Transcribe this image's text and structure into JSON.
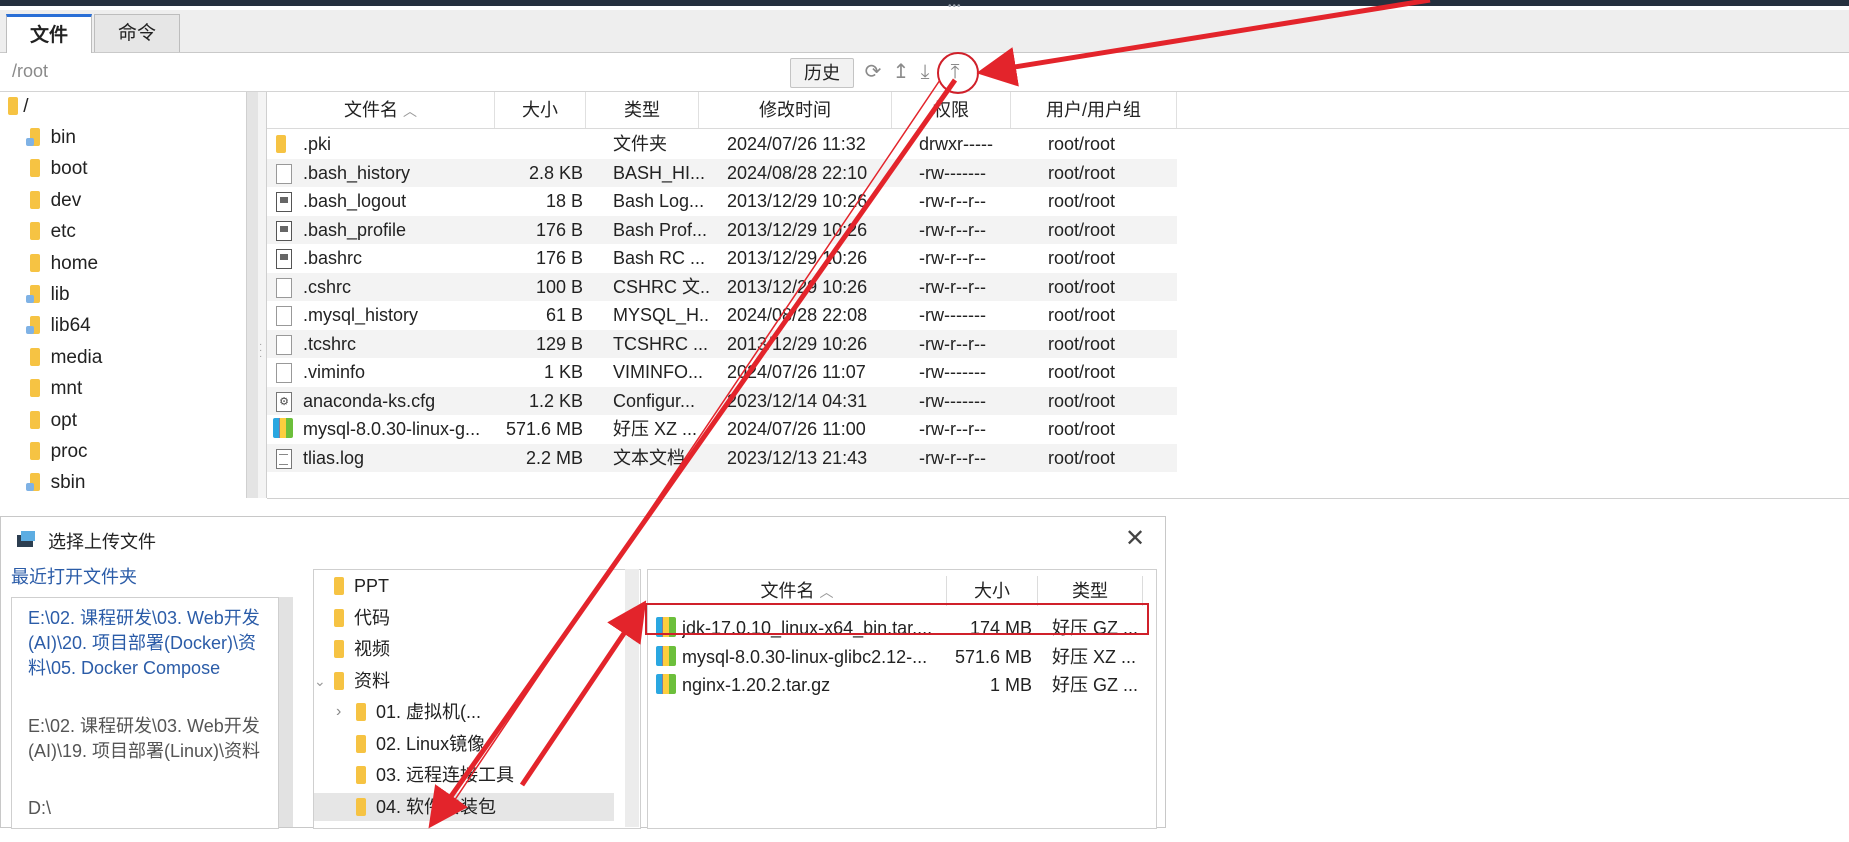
{
  "tabs": [
    {
      "label": "文件",
      "active": true
    },
    {
      "label": "命令",
      "active": false
    }
  ],
  "path_bar": {
    "path": "/root",
    "history_label": "历史",
    "icons": [
      "refresh-icon",
      "up-directory-icon",
      "download-icon",
      "upload-icon"
    ]
  },
  "tree": {
    "root": "/",
    "items": [
      "bin",
      "boot",
      "dev",
      "etc",
      "home",
      "lib",
      "lib64",
      "media",
      "mnt",
      "opt",
      "proc",
      "sbin"
    ]
  },
  "file_list": {
    "columns": [
      "文件名",
      "大小",
      "类型",
      "修改时间",
      "权限",
      "用户/用户组"
    ],
    "rows": [
      {
        "name": ".pki",
        "size": "",
        "type": "文件夹",
        "modified": "2024/07/26 11:32",
        "perm": "drwxr-----",
        "owner": "root/root",
        "icon": "folder"
      },
      {
        "name": ".bash_history",
        "size": "2.8 KB",
        "type": "BASH_HI...",
        "modified": "2024/08/28 22:10",
        "perm": "-rw-------",
        "owner": "root/root",
        "icon": "doc"
      },
      {
        "name": ".bash_logout",
        "size": "18 B",
        "type": "Bash Log...",
        "modified": "2013/12/29 10:26",
        "perm": "-rw-r--r--",
        "owner": "root/root",
        "icon": "doc2"
      },
      {
        "name": ".bash_profile",
        "size": "176 B",
        "type": "Bash Prof...",
        "modified": "2013/12/29 10:26",
        "perm": "-rw-r--r--",
        "owner": "root/root",
        "icon": "doc2"
      },
      {
        "name": ".bashrc",
        "size": "176 B",
        "type": "Bash RC ...",
        "modified": "2013/12/29 10:26",
        "perm": "-rw-r--r--",
        "owner": "root/root",
        "icon": "doc2"
      },
      {
        "name": ".cshrc",
        "size": "100 B",
        "type": "CSHRC 文...",
        "modified": "2013/12/29 10:26",
        "perm": "-rw-r--r--",
        "owner": "root/root",
        "icon": "doc"
      },
      {
        "name": ".mysql_history",
        "size": "61 B",
        "type": "MYSQL_H...",
        "modified": "2024/08/28 22:08",
        "perm": "-rw-------",
        "owner": "root/root",
        "icon": "doc"
      },
      {
        "name": ".tcshrc",
        "size": "129 B",
        "type": "TCSHRC ...",
        "modified": "2013/12/29 10:26",
        "perm": "-rw-r--r--",
        "owner": "root/root",
        "icon": "doc"
      },
      {
        "name": ".viminfo",
        "size": "1 KB",
        "type": "VIMINFO...",
        "modified": "2024/07/26 11:07",
        "perm": "-rw-------",
        "owner": "root/root",
        "icon": "doc"
      },
      {
        "name": "anaconda-ks.cfg",
        "size": "1.2 KB",
        "type": "Configur...",
        "modified": "2023/12/14 04:31",
        "perm": "-rw-------",
        "owner": "root/root",
        "icon": "cfg"
      },
      {
        "name": "mysql-8.0.30-linux-g...",
        "size": "571.6 MB",
        "type": "好压 XZ ...",
        "modified": "2024/07/26 11:00",
        "perm": "-rw-r--r--",
        "owner": "root/root",
        "icon": "archive"
      },
      {
        "name": "tlias.log",
        "size": "2.2 MB",
        "type": "文本文档",
        "modified": "2023/12/13 21:43",
        "perm": "-rw-r--r--",
        "owner": "root/root",
        "icon": "log"
      }
    ]
  },
  "dialog": {
    "title": "选择上传文件",
    "close_glyph": "✕",
    "recent_label": "最近打开文件夹",
    "recent_items": [
      {
        "text": "E:\\02. 课程研发\\03. Web开发(AI)\\20. 项目部署(Docker)\\资料\\05. Docker Compose",
        "highlight": true
      },
      {
        "text": "E:\\02. 课程研发\\03. Web开发(AI)\\19. 项目部署(Linux)\\资料",
        "highlight": false
      },
      {
        "text": "D:\\",
        "highlight": false
      }
    ],
    "folder_tree": [
      {
        "label": "PPT",
        "indent": 0,
        "expander": ""
      },
      {
        "label": "代码",
        "indent": 0,
        "expander": ""
      },
      {
        "label": "视频",
        "indent": 0,
        "expander": ""
      },
      {
        "label": "资料",
        "indent": 0,
        "expander": "expanded"
      },
      {
        "label": "01. 虚拟机(...",
        "indent": 1,
        "expander": "collapsed"
      },
      {
        "label": "02. Linux镜像",
        "indent": 1,
        "expander": ""
      },
      {
        "label": "03. 远程连接工具",
        "indent": 1,
        "expander": ""
      },
      {
        "label": "04. 软件安装包",
        "indent": 1,
        "expander": "",
        "selected": true
      }
    ],
    "file_columns": [
      "文件名",
      "大小",
      "类型"
    ],
    "files": [
      {
        "name": "jdk-17.0.10_linux-x64_bin.tar....",
        "size": "174 MB",
        "type": "好压 GZ ...",
        "highlighted": true
      },
      {
        "name": "mysql-8.0.30-linux-glibc2.12-...",
        "size": "571.6 MB",
        "type": "好压 XZ ...",
        "highlighted": false
      },
      {
        "name": "nginx-1.20.2.tar.gz",
        "size": "1 MB",
        "type": "好压 GZ ...",
        "highlighted": false
      }
    ]
  },
  "annotation_color": "#d0202a"
}
